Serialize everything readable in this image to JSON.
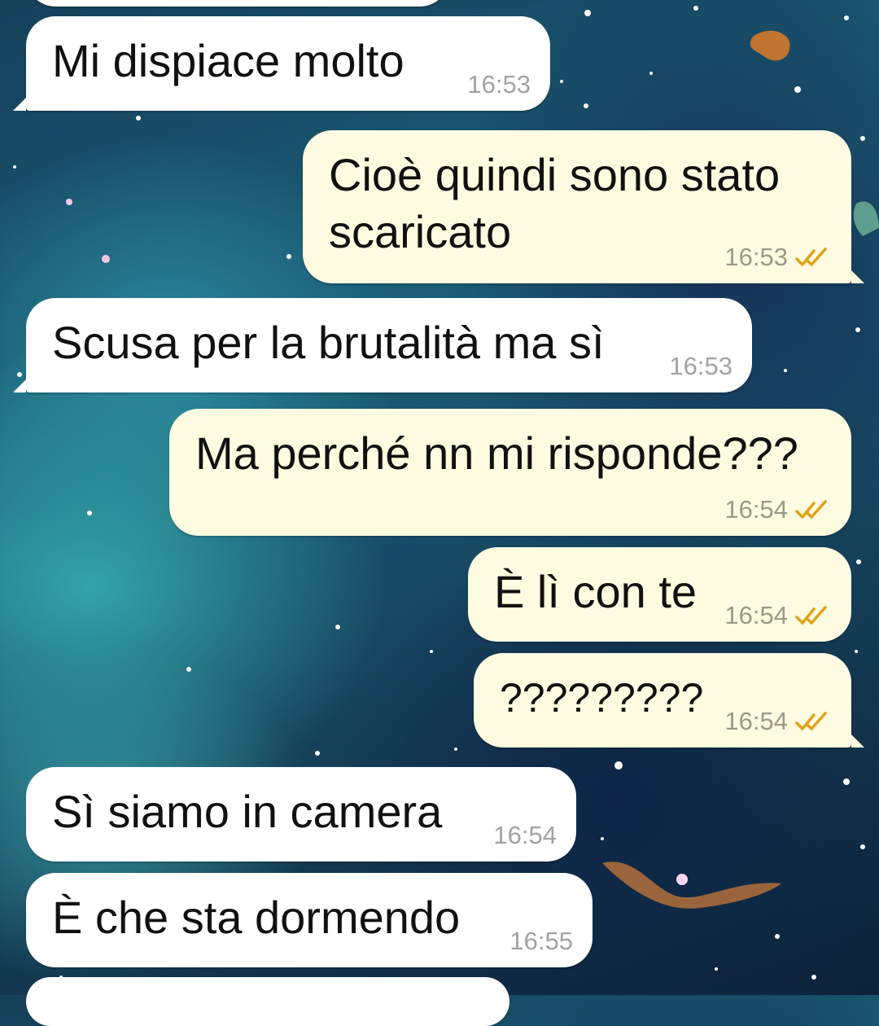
{
  "colors": {
    "incoming_bubble": "#ffffff",
    "outgoing_bubble": "#fdfbe0",
    "read_tick": "#e0a21a",
    "time_text": "#9a9a8a"
  },
  "messages": [
    {
      "text": "Mi dispiace molto",
      "time": "16:53",
      "direction": "incoming"
    },
    {
      "text": "Cioè quindi sono stato scaricato",
      "time": "16:53",
      "direction": "outgoing",
      "status": "read-ticks-icon"
    },
    {
      "text": "Scusa per la brutalità ma sì",
      "time": "16:53",
      "direction": "incoming"
    },
    {
      "text": "Ma perché nn mi risponde???",
      "time": "16:54",
      "direction": "outgoing",
      "status": "read-ticks-icon"
    },
    {
      "text": "È lì con te",
      "time": "16:54",
      "direction": "outgoing",
      "status": "read-ticks-icon"
    },
    {
      "text": "?????????",
      "time": "16:54",
      "direction": "outgoing",
      "status": "read-ticks-icon"
    },
    {
      "text": "Sì siamo in camera",
      "time": "16:54",
      "direction": "incoming"
    },
    {
      "text": "È che sta dormendo",
      "time": "16:55",
      "direction": "incoming"
    }
  ]
}
